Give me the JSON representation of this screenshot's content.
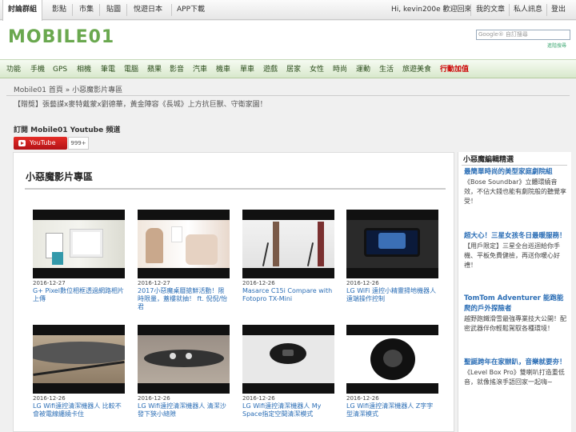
{
  "topbar": {
    "tabs": [
      "討論群組",
      "影點",
      "市集",
      "貼圖",
      "悅遊日本",
      "APP下載"
    ],
    "greeting": "Hi, kevin200e 歡迎回來",
    "links": [
      "我的文章",
      "私人訊息",
      "登出"
    ]
  },
  "header": {
    "logo": "MOBILE01",
    "search_placeholder": "Google® 自訂搜尋",
    "search_note": "進階搜尋"
  },
  "nav": {
    "items": [
      "功能",
      "手機",
      "GPS",
      "相機",
      "筆電",
      "電腦",
      "蘋果",
      "影音",
      "汽車",
      "機車",
      "單車",
      "遊戲",
      "居家",
      "女性",
      "時尚",
      "運動",
      "生活",
      "旅遊美食"
    ],
    "hot": "行動加值"
  },
  "breadcrumb": "Mobile01 首頁 » 小惡魔影片專區",
  "news": "【贈獎】張藝謀x麥特戴蒙x劉德華，黃金陣容《長城》上方抗巨獸、守衛家園！",
  "subscribe": {
    "title": "訂閱 Mobile01 Youtube 頻道",
    "button": "YouTube",
    "count": "999+"
  },
  "main": {
    "title": "小惡魔影片專區",
    "videos": [
      {
        "date": "2016-12-27",
        "title": "G+ Pixel數位相框透過網路相片上傳"
      },
      {
        "date": "2016-12-27",
        "title": "2017小惡魔桌曆搶鮮活動！限時限量，蓋樓就抽！ ft. 倪倪/怡君"
      },
      {
        "date": "2016-12-26",
        "title": "Masarce C15i Compare with Fotopro TX-Mini"
      },
      {
        "date": "2016-12-26",
        "title": "LG WiFi 遠控小精靈掃地機器人遠端操作控制"
      },
      {
        "date": "2016-12-26",
        "title": "LG Wifi遠控清潔機器人 比較不會被電線纏繞卡住"
      },
      {
        "date": "2016-12-26",
        "title": "LG Wifi遠控清潔機器人 清潔沙發下狹小縫隙"
      },
      {
        "date": "2016-12-26",
        "title": "LG Wifi遠控清潔機器人 My Space指定空間清潔模式"
      },
      {
        "date": "2016-12-26",
        "title": "LG Wifi遠控清潔機器人 Z字字型清潔模式"
      }
    ]
  },
  "sidebar": {
    "title": "小惡魔編輯精選",
    "items": [
      {
        "title": "最簡單時尚的美型家庭劇院組",
        "desc": "《Bose Soundbar》立體環繞音效，不佔大錢也能有劇院般的聽覺享受！"
      },
      {
        "title": "超大心！三星女孩冬日最暖服務！",
        "desc": "【用戶限定】三星全台巡迴給你手機、平板免費健檢，再送你暖心好禮！"
      },
      {
        "title": "TomTom Adventurer 能跑能爬的戶外探險者",
        "desc": "越野跑鐵滑雪最強專業技大公開！配密武器伴你輕鬆駕馭各種環境！"
      },
      {
        "title": "聖誕跨年在家辦趴，音樂就要夯！",
        "desc": "《Level Box Pro》雙喇叭打造重低音，就像搖滾手語回家一起嗨~"
      }
    ]
  }
}
